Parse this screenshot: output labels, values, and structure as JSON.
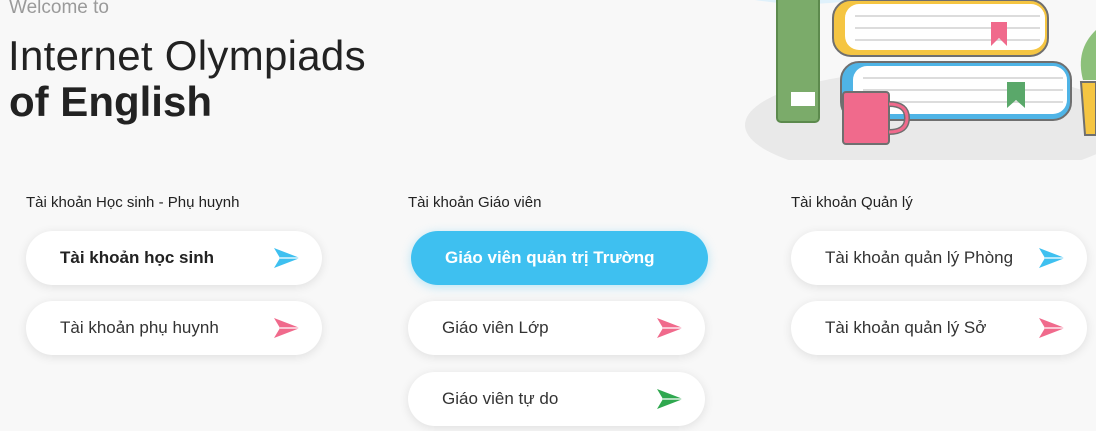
{
  "header": {
    "welcome": "Welcome to",
    "title_line1": "Internet Olympiads",
    "title_line2": "of English"
  },
  "groups": [
    {
      "label": "Tài khoản Học sinh - Phụ huynh",
      "buttons": [
        {
          "label": "Tài khoản học sinh",
          "icon": "send-icon",
          "color": "#3ec0f0"
        },
        {
          "label": "Tài khoản phụ huynh",
          "icon": "send-icon",
          "color": "#f06a8c"
        }
      ]
    },
    {
      "label": "Tài khoản Giáo viên",
      "buttons": [
        {
          "label": "Giáo viên quản trị Trường",
          "icon": "none",
          "color": "#3ec0f0"
        },
        {
          "label": "Giáo viên Lớp",
          "icon": "send-icon",
          "color": "#f06a8c"
        },
        {
          "label": "Giáo viên tự do",
          "icon": "send-icon",
          "color": "#2fa84f"
        }
      ]
    },
    {
      "label": "Tài khoản Quản lý",
      "buttons": [
        {
          "label": "Tài khoản quản lý Phòng",
          "icon": "send-icon",
          "color": "#3ec0f0"
        },
        {
          "label": "Tài khoản quản lý Sở",
          "icon": "send-icon",
          "color": "#f06a8c"
        }
      ]
    }
  ],
  "colors": {
    "accent": "#3ec0f0",
    "pink": "#f06a8c",
    "green": "#2fa84f",
    "background": "#f8f8f8"
  }
}
